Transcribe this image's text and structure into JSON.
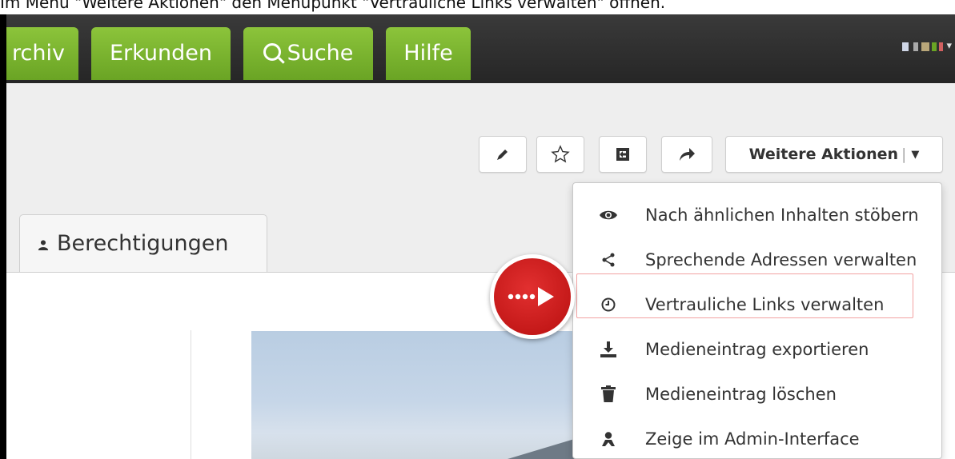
{
  "caption": "Im Menü \"Weitere Aktionen\" den Menüpunkt \"Vertrauliche Links verwalten\" öffnen.",
  "nav": {
    "tabs": [
      {
        "label": "rchiv"
      },
      {
        "label": "Erkunden"
      },
      {
        "label": "Suche",
        "icon": "search-icon"
      },
      {
        "label": "Hilfe"
      }
    ],
    "user_caret": "▾"
  },
  "toolbar": {
    "more_label": "Weitere Aktionen",
    "separator": "|",
    "caret": "▼"
  },
  "tabs": {
    "permissions_label": "Berechtigungen"
  },
  "menu": {
    "items": [
      {
        "label": "Nach ähnlichen Inhalten stöbern",
        "icon": "eye-icon"
      },
      {
        "label": "Sprechende Adressen verwalten",
        "icon": "share-icon"
      },
      {
        "label": "Vertrauliche Links verwalten",
        "icon": "clock-icon",
        "highlighted": true
      },
      {
        "label": "Medieneintrag exportieren",
        "icon": "download-icon"
      },
      {
        "label": "Medieneintrag löschen",
        "icon": "trash-icon"
      },
      {
        "label": "Zeige im Admin-Interface",
        "icon": "admin-user-icon"
      }
    ]
  },
  "colors": {
    "nav_green": "#7ab52f",
    "badge_red": "#d21f1f",
    "highlight_border": "#f2a2a2"
  }
}
